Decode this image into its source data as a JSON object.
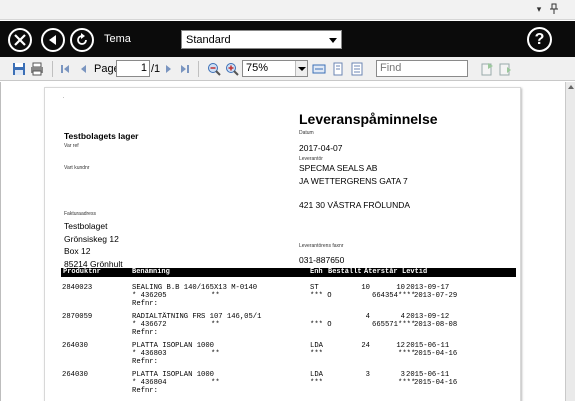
{
  "window": {
    "caption_buttons": [
      "▾",
      "pin-icon"
    ]
  },
  "command_bar": {
    "tema_label": "Tema",
    "tema_value": "Standard",
    "help_symbol": "?",
    "icons": [
      "close-icon",
      "back-icon",
      "refresh-icon",
      "help-icon"
    ]
  },
  "toolbar": {
    "page_label": "Page",
    "page_value": "1",
    "page_total": "/1",
    "zoom_value": "75%",
    "find_placeholder": "Find"
  },
  "report": {
    "dot": ".",
    "title": "Leveranspåminnelse",
    "company": "Testbolagets lager",
    "var_ref_label": "Var ref",
    "vart_kundnr_label": "Vart kundnr",
    "datum_label": "Datum",
    "date": "2017-04-07",
    "leverantor_label": "Leverantör",
    "supplier_name": "SPECMA SEALS AB",
    "supplier_street": "JA WETTERGRENS GATA 7",
    "supplier_city": "421 30 VÄSTRA FRÖLUNDA",
    "fakturaadress_label": "Fakturaadress",
    "billing_name": "Testbolaget",
    "billing_street": "Grönsiskeg 12",
    "billing_box": "Box 12",
    "billing_city": "85214 Grönhult",
    "lev_fax_label": "Leverantörens faxnr",
    "supplier_fax": "031-887650",
    "columns": [
      "Produktnr",
      "Benämning",
      "Enh",
      "Beställt",
      "Återstår",
      "Levtid"
    ],
    "rows": [
      {
        "prodnr": "2840023",
        "name": "SEALING B.B 140/165X13 M-0140",
        "unit": "ST",
        "ordered": "10",
        "remaining": "10",
        "levtid": "2013-09-17",
        "ref_line": "* 436205",
        "stars": "**",
        "order_mark": "*** O",
        "order_no": "664354",
        "stars2": "****",
        "date2": "2013-07-29",
        "refnr": "Refnr:"
      },
      {
        "prodnr": "2870059",
        "name": "RADIALTÄTNING FRS 107 146,05/1",
        "unit": "",
        "ordered": "4",
        "remaining": "4",
        "levtid": "2013-09-12",
        "ref_line": "* 436672",
        "stars": "**",
        "order_mark": "*** O",
        "order_no": "665571",
        "stars2": "****",
        "date2": "2013-08-08",
        "refnr": "Refnr:"
      },
      {
        "prodnr": "264030",
        "name": "PLATTA ISOPLAN 1000",
        "unit": "LDA",
        "ordered": "24",
        "remaining": "12",
        "levtid": "2015-06-11",
        "ref_line": "* 436803",
        "stars": "**",
        "order_mark": "***",
        "order_no": "",
        "stars2": "****",
        "date2": "2015-04-16",
        "refnr": "Refnr:"
      },
      {
        "prodnr": "264030",
        "name": "PLATTA ISOPLAN 1000",
        "unit": "LDA",
        "ordered": "3",
        "remaining": "3",
        "levtid": "2015-06-11",
        "ref_line": "* 436804",
        "stars": "**",
        "order_mark": "***",
        "order_no": "",
        "stars2": "****",
        "date2": "2015-04-16",
        "refnr": "Refnr:"
      }
    ]
  }
}
